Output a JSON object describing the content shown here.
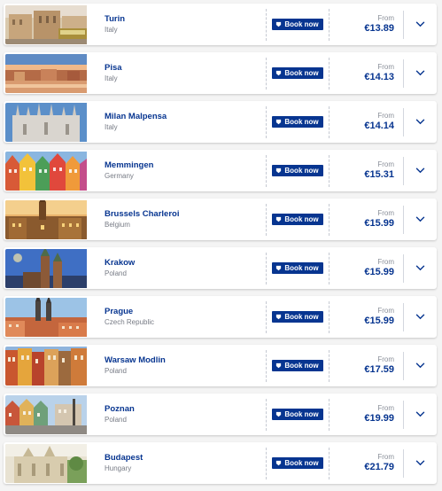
{
  "book_label": "Book now",
  "from_label": "From",
  "colors": {
    "brand": "#073590",
    "background": "#f4f4f4",
    "card": "#ffffff",
    "muted": "#777b85"
  },
  "destinations": [
    {
      "city": "Turin",
      "country": "Italy",
      "price": "€13.89",
      "image": "turin-square-tram"
    },
    {
      "city": "Pisa",
      "country": "Italy",
      "price": "€14.13",
      "image": "pisa-river-sunset"
    },
    {
      "city": "Milan Malpensa",
      "country": "Italy",
      "price": "€14.14",
      "image": "milan-cathedral"
    },
    {
      "city": "Memmingen",
      "country": "Germany",
      "price": "€15.31",
      "image": "memmingen-colorful-houses"
    },
    {
      "city": "Brussels Charleroi",
      "country": "Belgium",
      "price": "€15.99",
      "image": "brussels-grand-place"
    },
    {
      "city": "Krakow",
      "country": "Poland",
      "price": "€15.99",
      "image": "krakow-church-towers"
    },
    {
      "city": "Prague",
      "country": "Czech Republic",
      "price": "€15.99",
      "image": "prague-old-town"
    },
    {
      "city": "Warsaw Modlin",
      "country": "Poland",
      "price": "€17.59",
      "image": "warsaw-old-town-facades"
    },
    {
      "city": "Poznan",
      "country": "Poland",
      "price": "€19.99",
      "image": "poznan-old-market"
    },
    {
      "city": "Budapest",
      "country": "Hungary",
      "price": "€21.79",
      "image": "budapest-fishermans-bastion"
    }
  ]
}
